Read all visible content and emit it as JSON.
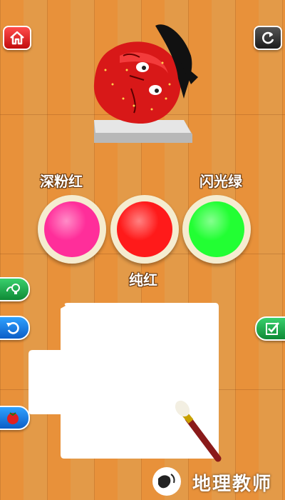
{
  "colors": {
    "left": {
      "label": "深粉红",
      "hex": "#ff2e9a"
    },
    "middle": {
      "label": "纯红",
      "hex": "#ff1a1a"
    },
    "right": {
      "label": "闪光绿",
      "hex": "#22ff33"
    }
  },
  "buttons": {
    "home": "home-icon",
    "restart": "refresh-icon",
    "hint": "lightbulb-icon",
    "undo": "undo-icon",
    "done": "checkmark-icon",
    "reference": "strawberry-icon"
  },
  "watermark": "地理教师"
}
